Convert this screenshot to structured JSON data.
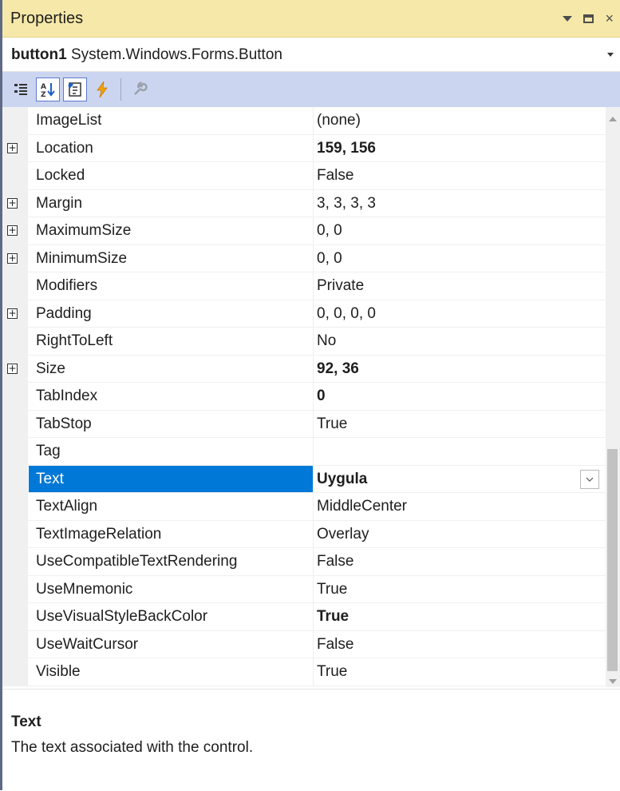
{
  "window": {
    "title": "Properties",
    "controls": {
      "dropdown": "chevron-down-icon",
      "maximize": "maximize-icon",
      "close": "×"
    }
  },
  "object_selector": {
    "name": "button1",
    "type": "System.Windows.Forms.Button"
  },
  "toolbar": {
    "buttons": [
      "categorized-icon",
      "alphabetical-icon",
      "properties-icon",
      "events-icon",
      "property-pages-icon"
    ]
  },
  "properties": [
    {
      "name": "ImageList",
      "value": "(none)",
      "bold": false,
      "expandable": false
    },
    {
      "name": "Location",
      "value": "159, 156",
      "bold": true,
      "expandable": true
    },
    {
      "name": "Locked",
      "value": "False",
      "bold": false,
      "expandable": false
    },
    {
      "name": "Margin",
      "value": "3, 3, 3, 3",
      "bold": false,
      "expandable": true
    },
    {
      "name": "MaximumSize",
      "value": "0, 0",
      "bold": false,
      "expandable": true
    },
    {
      "name": "MinimumSize",
      "value": "0, 0",
      "bold": false,
      "expandable": true
    },
    {
      "name": "Modifiers",
      "value": "Private",
      "bold": false,
      "expandable": false
    },
    {
      "name": "Padding",
      "value": "0, 0, 0, 0",
      "bold": false,
      "expandable": true
    },
    {
      "name": "RightToLeft",
      "value": "No",
      "bold": false,
      "expandable": false
    },
    {
      "name": "Size",
      "value": "92, 36",
      "bold": true,
      "expandable": true
    },
    {
      "name": "TabIndex",
      "value": "0",
      "bold": true,
      "expandable": false
    },
    {
      "name": "TabStop",
      "value": "True",
      "bold": false,
      "expandable": false
    },
    {
      "name": "Tag",
      "value": "",
      "bold": false,
      "expandable": false
    },
    {
      "name": "Text",
      "value": "Uygula",
      "bold": true,
      "expandable": false,
      "selected": true
    },
    {
      "name": "TextAlign",
      "value": "MiddleCenter",
      "bold": false,
      "expandable": false
    },
    {
      "name": "TextImageRelation",
      "value": "Overlay",
      "bold": false,
      "expandable": false
    },
    {
      "name": "UseCompatibleTextRendering",
      "value": "False",
      "bold": false,
      "expandable": false
    },
    {
      "name": "UseMnemonic",
      "value": "True",
      "bold": false,
      "expandable": false
    },
    {
      "name": "UseVisualStyleBackColor",
      "value": "True",
      "bold": true,
      "expandable": false
    },
    {
      "name": "UseWaitCursor",
      "value": "False",
      "bold": false,
      "expandable": false
    },
    {
      "name": "Visible",
      "value": "True",
      "bold": false,
      "expandable": false
    }
  ],
  "description": {
    "title": "Text",
    "text": "The text associated with the control."
  },
  "colors": {
    "title_bg": "#f6e8a8",
    "toolbar_bg": "#ccd5f0",
    "selection": "#0078d7"
  }
}
